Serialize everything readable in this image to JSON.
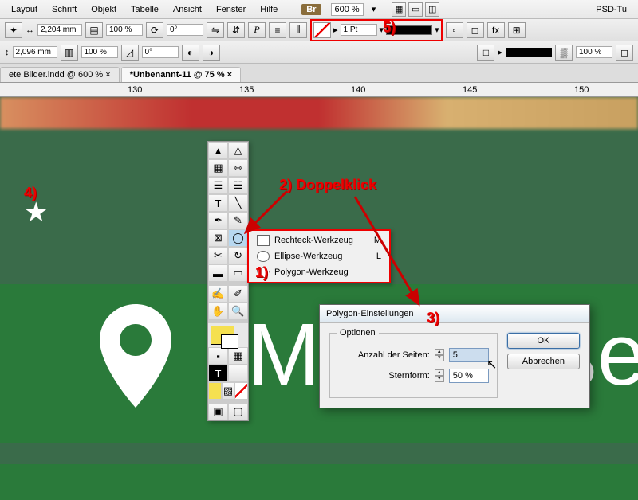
{
  "menu": {
    "layout": "Layout",
    "schrift": "Schrift",
    "objekt": "Objekt",
    "tabelle": "Tabelle",
    "ansicht": "Ansicht",
    "fenster": "Fenster",
    "hilfe": "Hilfe",
    "br": "Br",
    "zoom": "600 %",
    "app": "PSD-Tu"
  },
  "toolbar": {
    "w": "2,204 mm",
    "h": "2,096 mm",
    "pct1": "100 %",
    "pct2": "100 %",
    "deg1": "0°",
    "deg2": "0°",
    "pt": "1 Pt",
    "pct3": "100 %"
  },
  "tabs": {
    "t1": "ete Bilder.indd @ 600 %",
    "t2": "*Unbenannt-11 @ 75 %"
  },
  "ruler": {
    "r1": "130",
    "r2": "135",
    "r3": "140",
    "r4": "145",
    "r5": "150"
  },
  "flyout": {
    "rect": "Rechteck-Werkzeug",
    "rectk": "M",
    "ell": "Ellipse-Werkzeug",
    "ellk": "L",
    "poly": "Polygon-Werkzeug"
  },
  "dialog": {
    "title": "Polygon-Einstellungen",
    "optionen": "Optionen",
    "sides_label": "Anzahl der Seiten:",
    "sides": "5",
    "star_label": "Sternform:",
    "star": "50 %",
    "ok": "OK",
    "cancel": "Abbrechen"
  },
  "anno": {
    "a1": "1)",
    "a2": "2) Doppelklick",
    "a3": "3)",
    "a4": "4)",
    "a5": "5)"
  },
  "canvas": {
    "M": "M",
    "Be": "ße"
  }
}
